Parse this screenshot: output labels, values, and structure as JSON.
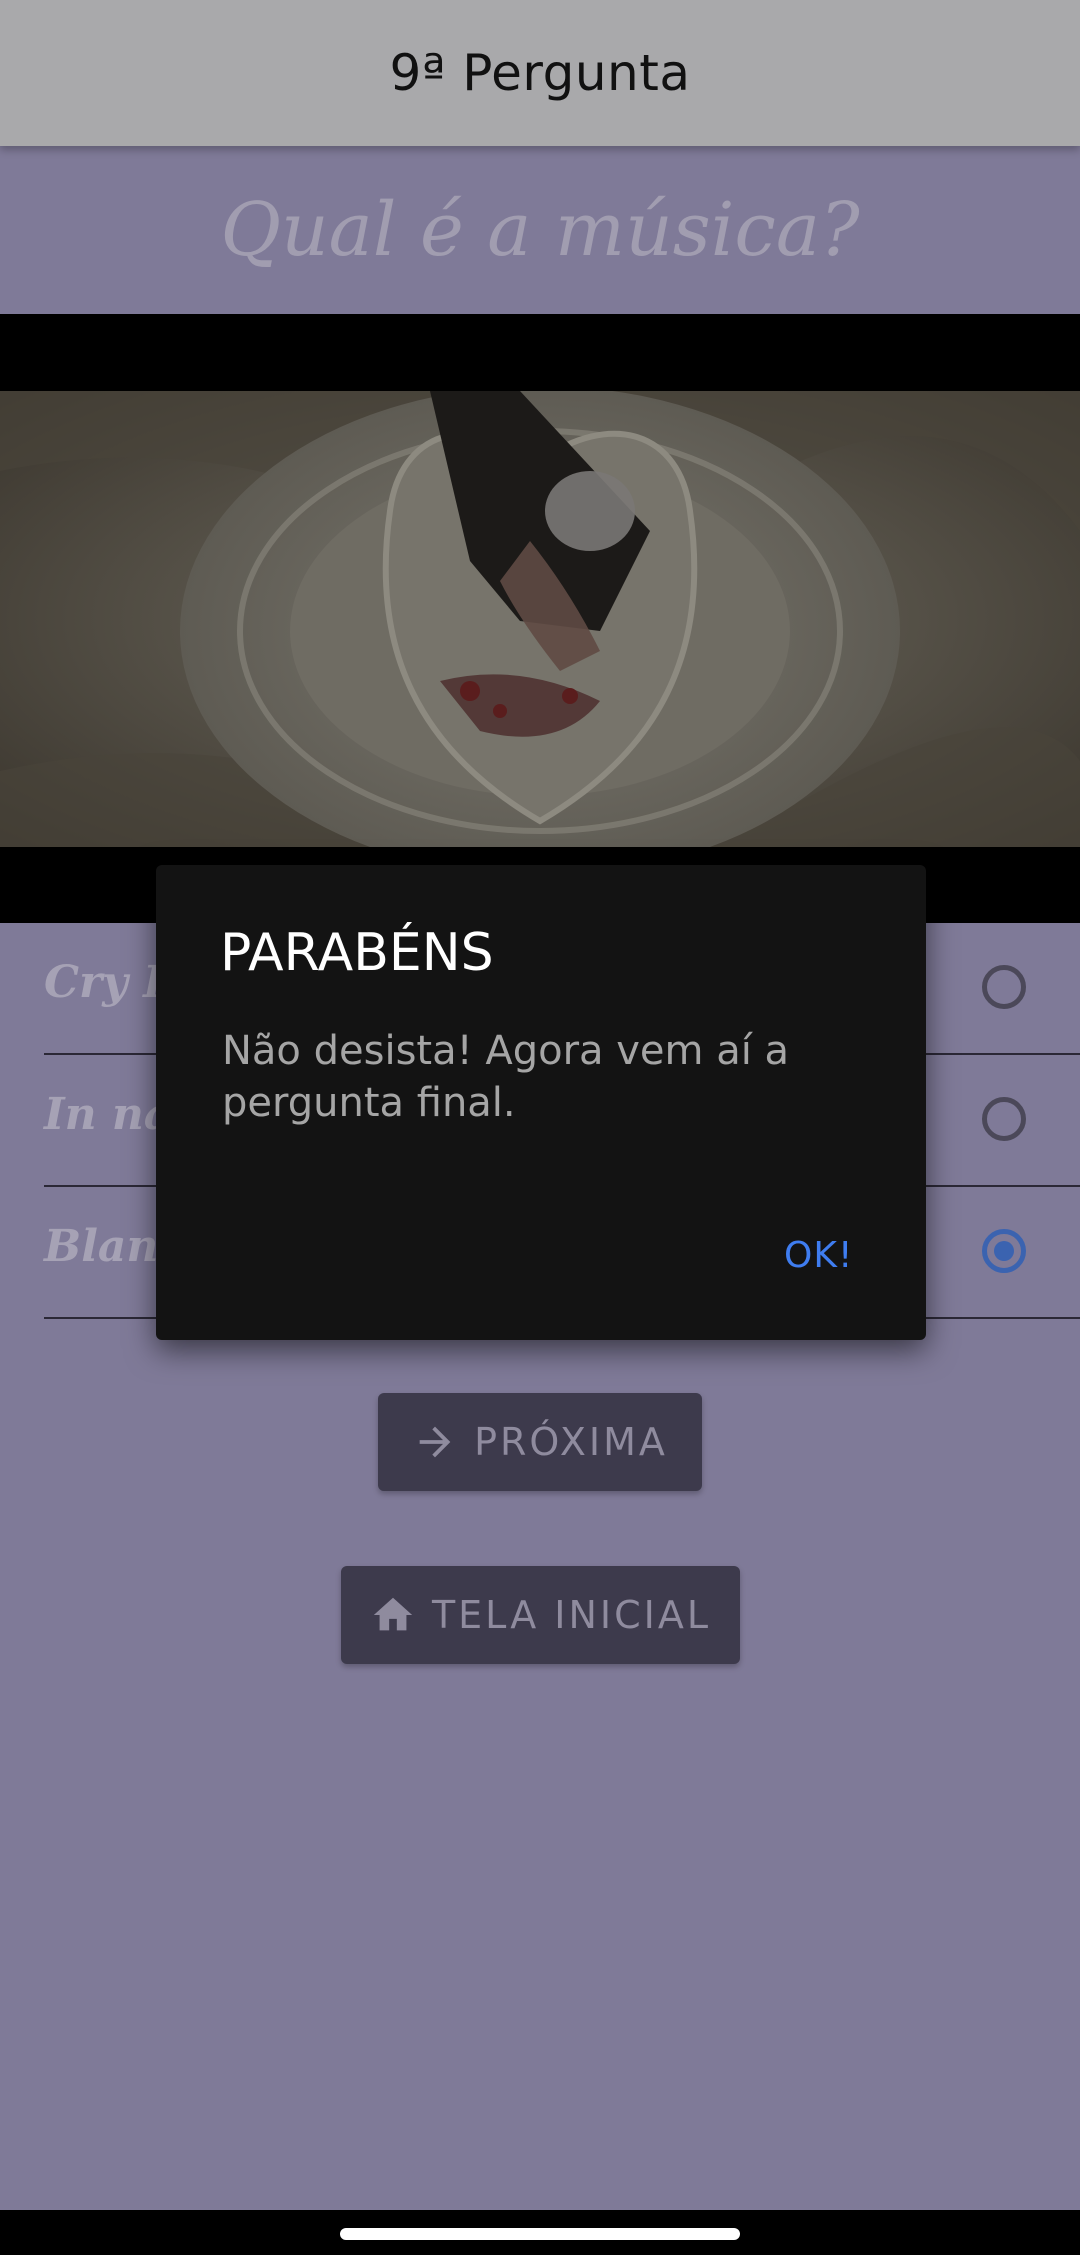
{
  "app_bar": {
    "title": "9ª Pergunta"
  },
  "question": {
    "text": "Qual é a música?"
  },
  "video": {
    "description_icon": "video-thumbnail"
  },
  "options": [
    {
      "label": "Cry Baby",
      "selected": false
    },
    {
      "label": "In name",
      "selected": false
    },
    {
      "label": "Blank",
      "selected": true
    }
  ],
  "buttons": {
    "next_label": "PRÓXIMA",
    "next_icon": "arrow-right-icon",
    "home_label": "TELA INICIAL",
    "home_icon": "home-icon"
  },
  "dialog": {
    "title": "PARABÉNS",
    "message": "Não desista! Agora vem aí a pergunta final.",
    "ok_label": "OK!"
  },
  "colors": {
    "background": "#7f7a98",
    "app_bar": "#a9a9ab",
    "dialog_bg": "#131313",
    "accent": "#3f7df0"
  }
}
